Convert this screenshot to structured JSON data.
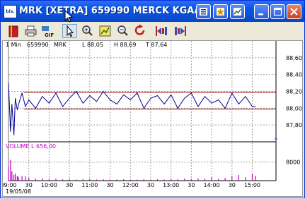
{
  "window": {
    "app_icon_text": "bis.",
    "title": "MRK [XETRA]  659990  MERCK KGAA O.N."
  },
  "titlebar_buttons": [
    "sheet-icon",
    "star-icon",
    "chart-icon",
    "minimize-icon",
    "maximize-icon",
    "close-icon"
  ],
  "toolbar": [
    {
      "name": "book-icon"
    },
    {
      "name": "printer-icon"
    },
    {
      "name": "gif-export-icon",
      "text": "GIF"
    },
    {
      "name": "pointer-tool-icon",
      "selected": true
    },
    {
      "name": "zoom-in-icon"
    },
    {
      "name": "zoom-region-icon"
    },
    {
      "name": "zoom-out-icon"
    },
    {
      "name": "refresh-icon"
    },
    {
      "name": "scroll-left-icon"
    },
    {
      "name": "scroll-right-icon"
    }
  ],
  "chart_header": {
    "interval": "1 Min",
    "wkn": "659990",
    "symbol": "MRK",
    "low": "L  88,05",
    "high": "H  88,69",
    "last": "T  87,64"
  },
  "volume_header": {
    "label": "VOLUME",
    "last": "L  656,00"
  },
  "colors": {
    "price_line": "#000090",
    "support_lines": "#a00000",
    "volume": "#c000c0",
    "grid": "#a0a0a0"
  },
  "chart_data": [
    {
      "type": "line",
      "title": "",
      "y_ticks": [
        "88,60",
        "88,40",
        "88,20",
        "88,00",
        "87,80"
      ],
      "x_ticks": [
        "09:00",
        "30",
        "10:00",
        "30",
        "11:00",
        "30",
        "12:00",
        "30",
        "13:00",
        "30",
        "14:00",
        "30",
        "15:00"
      ],
      "date_label": "19/05/08",
      "ylim": [
        87.6,
        88.7
      ],
      "hlines": [
        88.19,
        87.99
      ],
      "x": [
        "09:00",
        "09:03",
        "09:05",
        "09:08",
        "09:10",
        "09:13",
        "09:15",
        "09:20",
        "09:25",
        "09:30",
        "09:40",
        "09:50",
        "10:00",
        "10:10",
        "10:20",
        "10:30",
        "10:40",
        "10:50",
        "11:00",
        "11:10",
        "11:20",
        "11:30",
        "11:40",
        "11:50",
        "12:00",
        "12:10",
        "12:20",
        "12:30",
        "12:40",
        "12:50",
        "13:00",
        "13:10",
        "13:20",
        "13:30",
        "13:40",
        "13:50",
        "14:00",
        "14:10",
        "14:20",
        "14:30",
        "14:40",
        "14:50",
        "15:00",
        "15:05"
      ],
      "series": [
        {
          "values": [
            88.3,
            87.72,
            88.05,
            87.68,
            88.12,
            87.98,
            88.05,
            88.18,
            88.02,
            88.1,
            88.0,
            88.14,
            88.06,
            88.18,
            88.02,
            88.12,
            88.2,
            88.06,
            88.15,
            88.08,
            88.2,
            88.1,
            88.05,
            88.16,
            88.1,
            88.18,
            88.0,
            88.12,
            88.15,
            88.05,
            88.16,
            88.0,
            88.12,
            88.18,
            88.02,
            88.14,
            88.06,
            88.1,
            88.0,
            88.18,
            88.05,
            88.14,
            88.02,
            88.02
          ]
        }
      ]
    },
    {
      "type": "bar",
      "title": "",
      "y_ticks": [
        "8000"
      ],
      "ylim": [
        0,
        14000
      ],
      "values": [
        6000,
        9000,
        4000,
        2500,
        3000,
        2000,
        1500,
        2000,
        1800,
        1200,
        900,
        1000,
        700,
        900,
        600,
        800,
        500,
        600,
        700,
        500,
        600,
        400,
        500,
        600,
        400,
        500,
        700,
        400,
        600,
        500,
        800,
        600,
        900,
        700,
        1000,
        900,
        1500,
        800,
        1200,
        2000,
        2500,
        1500,
        3000,
        2000
      ]
    }
  ]
}
